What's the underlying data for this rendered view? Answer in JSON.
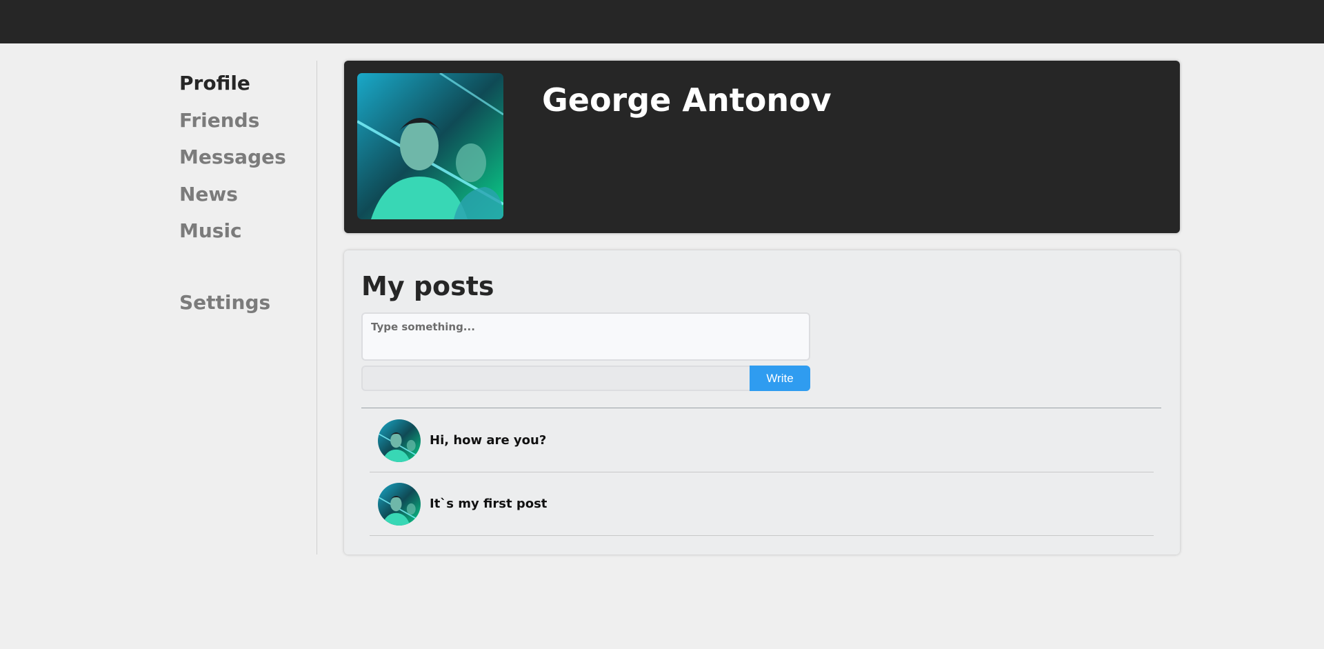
{
  "sidebar": {
    "items": [
      {
        "label": "Profile",
        "active": true
      },
      {
        "label": "Friends",
        "active": false
      },
      {
        "label": "Messages",
        "active": false
      },
      {
        "label": "News",
        "active": false
      },
      {
        "label": "Music",
        "active": false
      }
    ],
    "settings_label": "Settings"
  },
  "profile": {
    "name": "George Antonov",
    "avatar_icon": "user-photo"
  },
  "posts": {
    "title": "My posts",
    "input_placeholder": "Type something...",
    "write_label": "Write",
    "items": [
      {
        "text": "Hi, how are you?"
      },
      {
        "text": "It`s my first post"
      }
    ]
  },
  "colors": {
    "topbar": "#262626",
    "accent": "#2f9cf0",
    "nav_active": "#262626",
    "nav_inactive": "#7b7b7b"
  }
}
